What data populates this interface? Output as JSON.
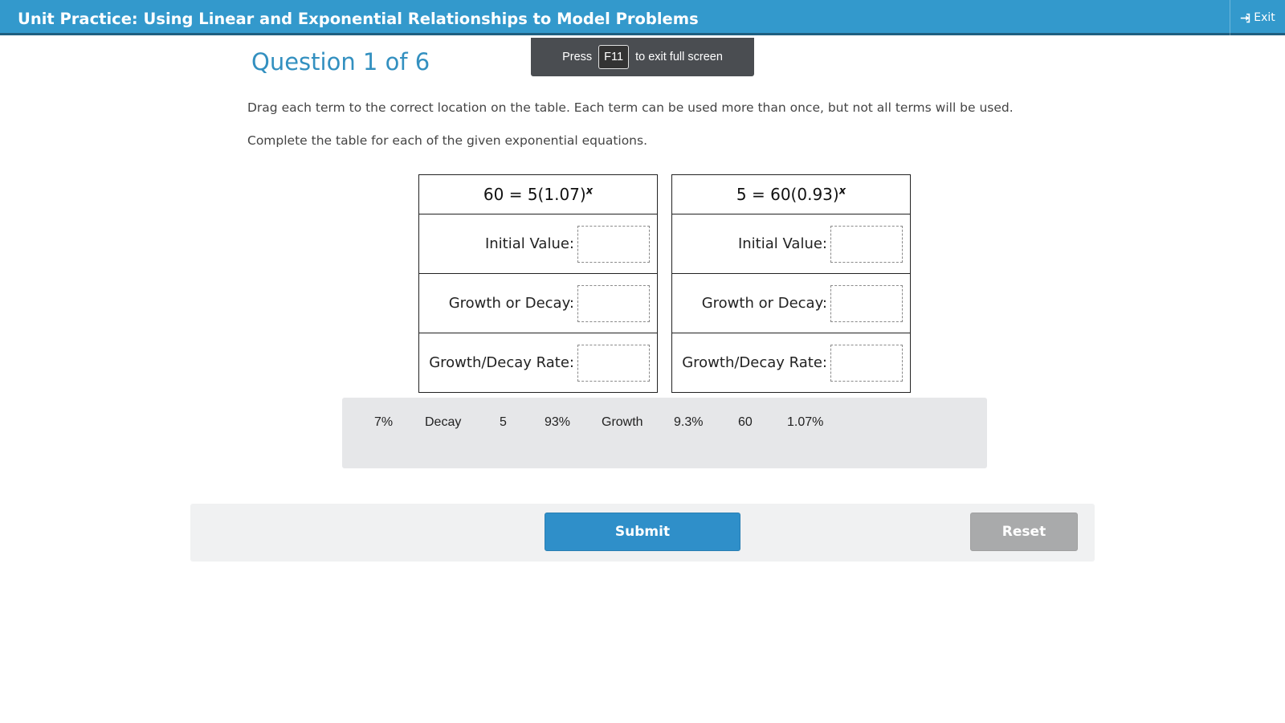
{
  "header": {
    "title": "Unit Practice: Using Linear and Exponential Relationships to Model Problems",
    "exit_label": "Exit"
  },
  "fullscreen_notice": {
    "press": "Press",
    "key": "F11",
    "suffix": "to exit full screen"
  },
  "question": {
    "title": "Question 1 of 6",
    "instruction_1": "Drag each term to the correct location on the table. Each term can be used more than once, but not all terms will be used.",
    "instruction_2": "Complete the table for each of the given exponential equations."
  },
  "tables": [
    {
      "equation": "60 = 5(1.07)",
      "exponent": "x",
      "rows": [
        {
          "label": "Initial Value:"
        },
        {
          "label": "Growth or Decay:"
        },
        {
          "label": "Growth/Decay Rate:"
        }
      ]
    },
    {
      "equation": "5 = 60(0.93)",
      "exponent": "x",
      "rows": [
        {
          "label": "Initial Value:"
        },
        {
          "label": "Growth or Decay:"
        },
        {
          "label": "Growth/Decay Rate:"
        }
      ]
    }
  ],
  "terms": [
    "7%",
    "Decay",
    "5",
    "93%",
    "Growth",
    "9.3%",
    "60",
    "1.07%"
  ],
  "footer": {
    "submit_label": "Submit",
    "reset_label": "Reset"
  },
  "colors": {
    "header_bg": "#3399cc",
    "accent": "#3390c0",
    "submit_bg": "#2f8fc9",
    "reset_bg": "#a9aaab"
  }
}
